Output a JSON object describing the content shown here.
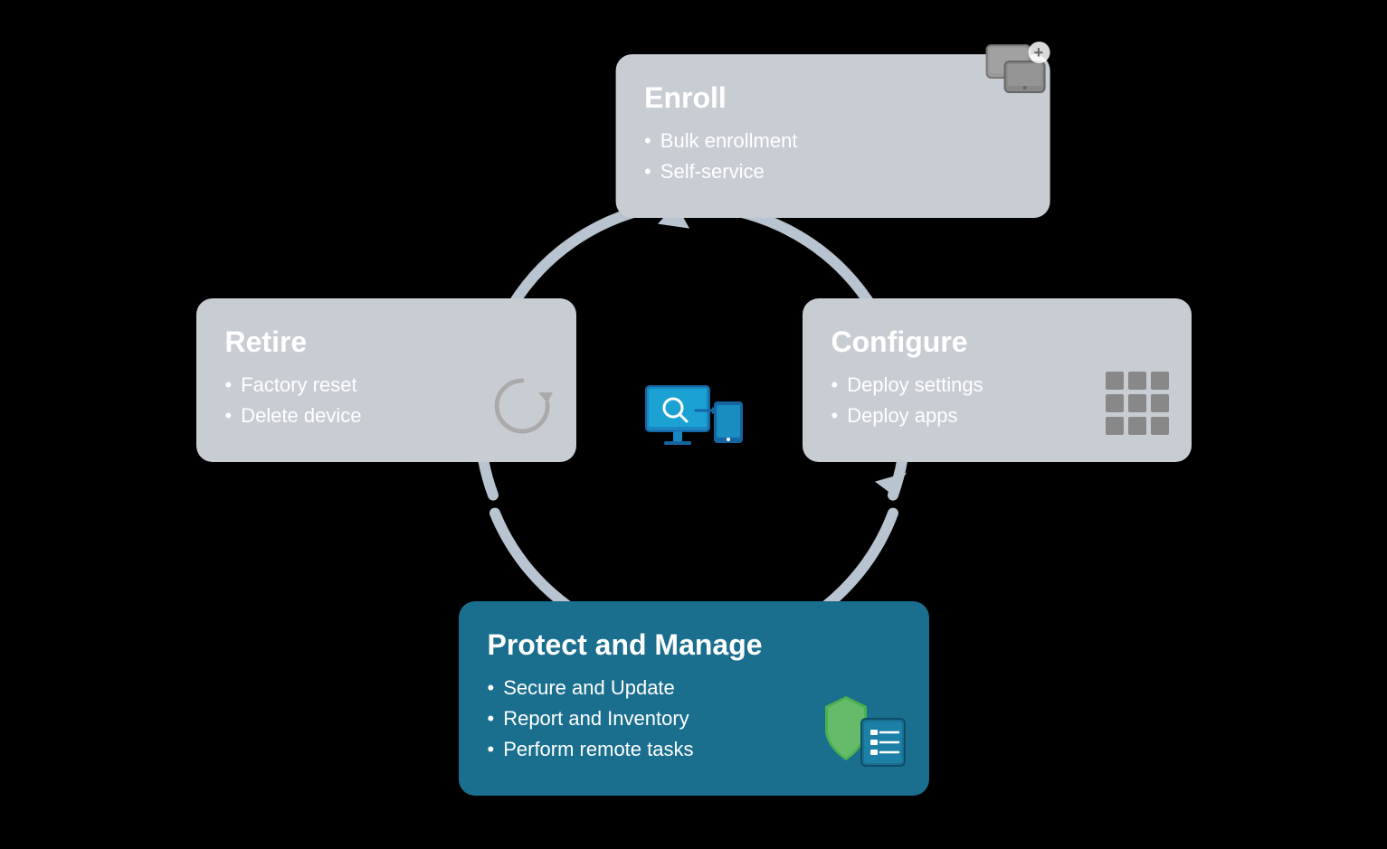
{
  "cards": {
    "enroll": {
      "title": "Enroll",
      "items": [
        "Bulk enrollment",
        "Self-service"
      ]
    },
    "configure": {
      "title": "Configure",
      "items": [
        "Deploy settings",
        "Deploy apps"
      ]
    },
    "retire": {
      "title": "Retire",
      "items": [
        "Factory reset",
        "Delete device"
      ]
    },
    "protect": {
      "title": "Protect and Manage",
      "items": [
        "Secure and Update",
        "Report and Inventory",
        "Perform remote tasks"
      ]
    }
  },
  "colors": {
    "card_bg": "#c8cdd4",
    "protect_bg": "#1a6e8e",
    "arrow_color": "#b0bcc8",
    "center_icon_blue": "#1a87c0",
    "center_icon_dark": "#1565a0"
  }
}
